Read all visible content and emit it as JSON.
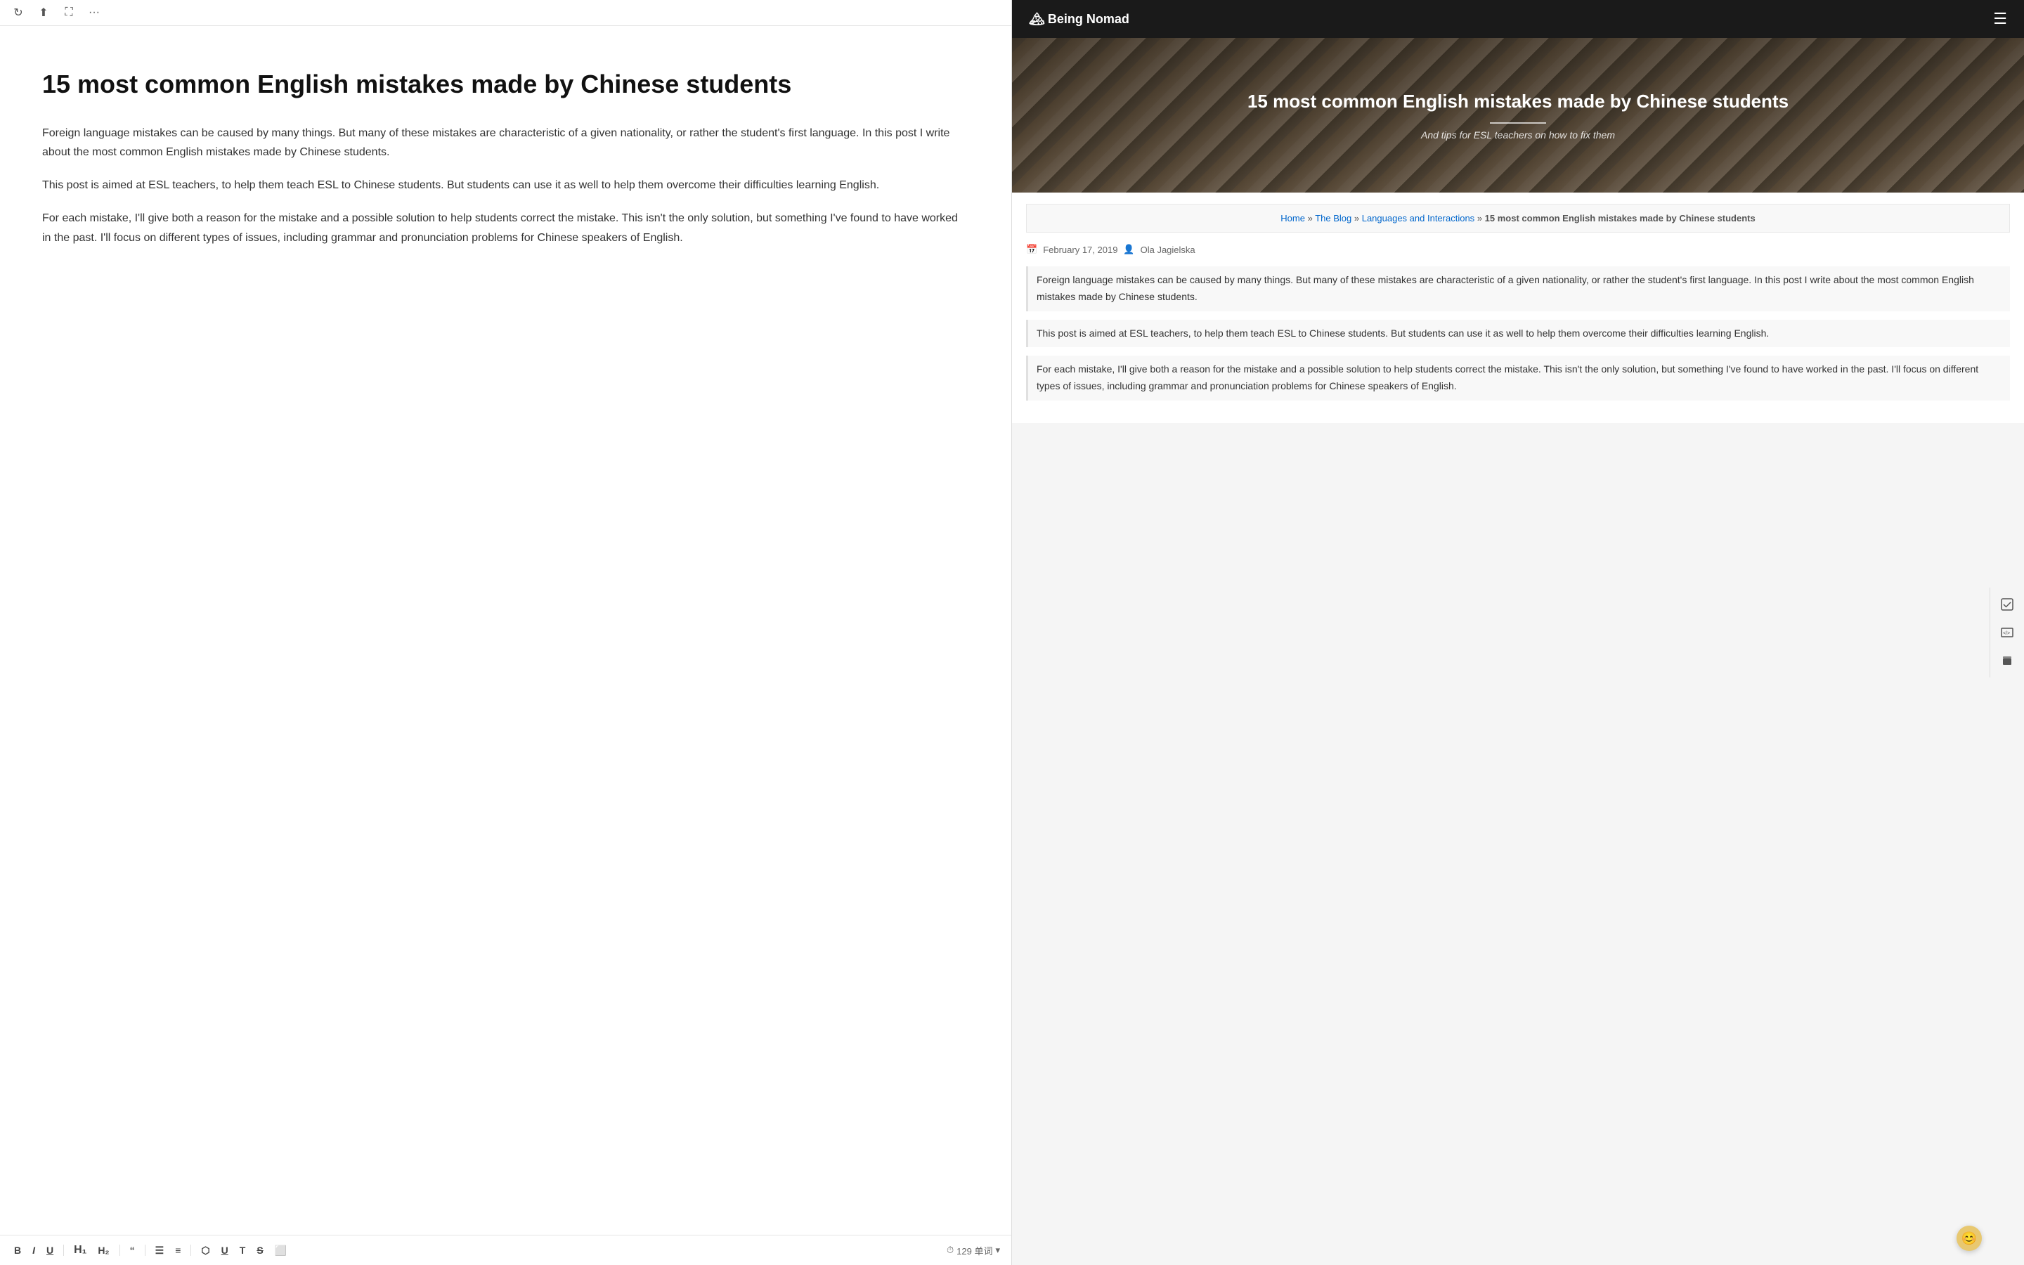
{
  "toolbar": {
    "refresh_icon": "↻",
    "share_icon": "⬆",
    "expand_icon": "⛶",
    "more_icon": "···"
  },
  "editor": {
    "title": "15 most common English mistakes made by Chinese students",
    "paragraphs": [
      "Foreign language mistakes can be caused by many things. But many of these mistakes are characteristic of a given nationality, or rather the student's first language. In this post I write about the most common English mistakes made by Chinese students.",
      "This post is aimed at ESL teachers, to help them teach ESL to Chinese students. But students can use it as well to help them overcome their difficulties learning English.",
      "For each mistake, I'll give both a reason for the mistake and a possible solution to help students correct the mistake. This isn't the only solution, but something I've found to have worked in the past. I'll focus on different types of issues, including grammar and pronunciation problems for Chinese speakers of English."
    ],
    "bottom_toolbar": {
      "bold": "B",
      "italic": "I",
      "underline": "U",
      "heading1": "H",
      "heading2": "H",
      "quote_open": "“",
      "list_unordered": "≡",
      "list_ordered": "≡",
      "link": "🔗",
      "underline2": "U",
      "text_type": "T",
      "strikethrough": "S",
      "image": "⬜",
      "clock_icon": "⏱",
      "word_count": "129 单词"
    }
  },
  "website": {
    "logo": "Being Nomad",
    "hero": {
      "title": "15 most common English mistakes made by Chinese students",
      "subtitle": "And tips for ESL teachers on how to fix them"
    },
    "breadcrumb": {
      "home": "Home",
      "blog": "The Blog",
      "category": "Languages and Interactions",
      "article": "15 most common English mistakes made by Chinese students",
      "separator": "»"
    },
    "post_meta": {
      "date": "February 17, 2019",
      "author": "Ola Jagielska"
    },
    "paragraphs": [
      "Foreign language mistakes can be caused by many things. But many of these mistakes are characteristic of a given nationality, or rather the student's first language. In this post I write about the most common English mistakes made by Chinese students.",
      "This post is aimed at ESL teachers, to help them teach ESL to Chinese students. But students can use it as well to help them overcome their difficulties learning English.",
      "For each mistake, I'll give both a reason for the mistake and a possible solution to help students correct the mistake. This isn't the only solution, but something I've found to have worked in the past. I'll focus on different types of issues, including grammar and pronunciation problems for Chinese speakers of English."
    ]
  },
  "side_icons": {
    "check": "☑",
    "code": "⌨",
    "layers": "⬛"
  },
  "emoji_feedback": "😊"
}
